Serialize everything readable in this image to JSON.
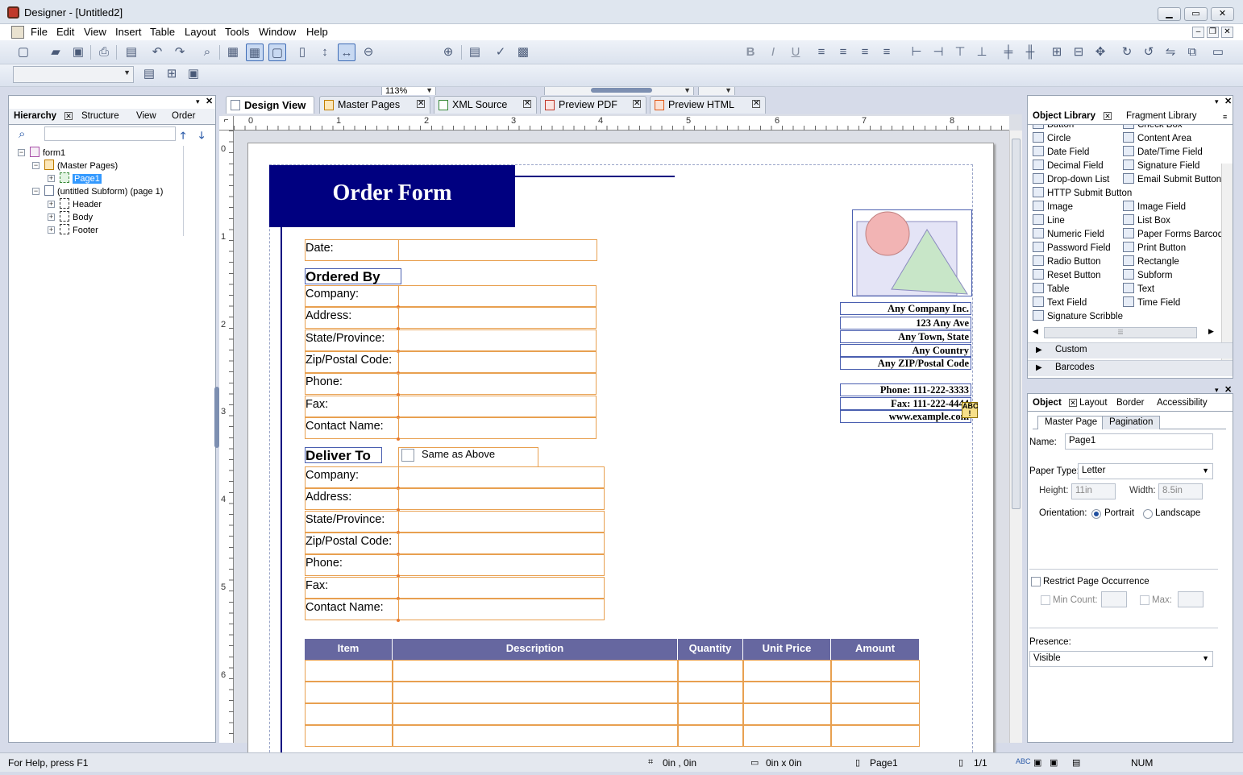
{
  "window": {
    "title": "Designer - [Untitled2]"
  },
  "menu": [
    "File",
    "Edit",
    "View",
    "Insert",
    "Table",
    "Layout",
    "Tools",
    "Window",
    "Help"
  ],
  "toolbar": {
    "zoom": "113%"
  },
  "hierarchy": {
    "tabs": [
      "Hierarchy",
      "Structure",
      "View",
      "Order"
    ],
    "search_value": "",
    "tree": [
      "form1",
      "(Master Pages)",
      "Page1",
      "(untitled Subform) (page 1)",
      "Header",
      "Body",
      "Footer"
    ]
  },
  "doc_tabs": [
    "Design View",
    "Master Pages",
    "XML Source",
    "Preview PDF",
    "Preview HTML"
  ],
  "rulers": {
    "h": [
      "0",
      "1",
      "2",
      "3",
      "4",
      "5",
      "6",
      "7",
      "8"
    ],
    "v": [
      "0",
      "1",
      "2",
      "3",
      "4",
      "5",
      "6"
    ]
  },
  "form": {
    "title": "Order Form",
    "date_label": "Date:",
    "ordered_by": "Ordered By",
    "deliver_to": "Deliver To",
    "same_as_above": "Same as Above",
    "ordered_fields": [
      "Company:",
      "Address:",
      "State/Province:",
      "Zip/Postal Code:",
      "Phone:",
      "Fax:",
      "Contact Name:"
    ],
    "deliver_fields": [
      "Company:",
      "Address:",
      "State/Province:",
      "Zip/Postal Code:",
      "Phone:",
      "Fax:",
      "Contact Name:"
    ],
    "company_lines": [
      "Any Company Inc.",
      "123 Any Ave",
      "Any Town, State",
      "Any Country",
      "Any ZIP/Postal Code"
    ],
    "contact_lines": [
      "Phone: 111-222-3333",
      "Fax: 111-222-4444",
      "www.example.com"
    ],
    "table_headers": [
      "Item",
      "Description",
      "Quantity",
      "Unit Price",
      "Amount"
    ]
  },
  "object_library": {
    "tabs": [
      "Object Library",
      "Fragment Library"
    ],
    "top_cut": [
      "Button",
      "Check Box"
    ],
    "left": [
      "Circle",
      "Date Field",
      "Decimal Field",
      "Drop-down List",
      "HTTP Submit Button",
      "Image",
      "Line",
      "Numeric Field",
      "Password Field",
      "Radio Button",
      "Reset Button",
      "Table",
      "Text Field",
      "Signature Scribble"
    ],
    "right": [
      "Content Area",
      "Date/Time Field",
      "Signature Field",
      "Email Submit Button",
      "",
      "Image Field",
      "List Box",
      "Paper Forms Barcode",
      "Print Button",
      "Rectangle",
      "Subform",
      "Text",
      "Time Field"
    ],
    "sections": [
      "Custom",
      "Barcodes"
    ]
  },
  "object_panel": {
    "tabs": [
      "Object",
      "Layout",
      "Border",
      "Accessibility"
    ],
    "subtabs": [
      "Master Page",
      "Pagination"
    ],
    "name_label": "Name:",
    "name_value": "Page1",
    "paper_type_label": "Paper Type:",
    "paper_type_value": "Letter",
    "height_label": "Height:",
    "height_value": "11in",
    "width_label": "Width:",
    "width_value": "8.5in",
    "orientation_label": "Orientation:",
    "portrait": "Portrait",
    "landscape": "Landscape",
    "restrict_label": "Restrict Page Occurrence",
    "min_count_label": "Min Count:",
    "max_label": "Max:",
    "presence_label": "Presence:",
    "presence_value": "Visible"
  },
  "status": {
    "help": "For Help, press F1",
    "position": "0in , 0in",
    "size": "0in x 0in",
    "page": "Page1",
    "pages": "1/1",
    "num": "NUM"
  }
}
